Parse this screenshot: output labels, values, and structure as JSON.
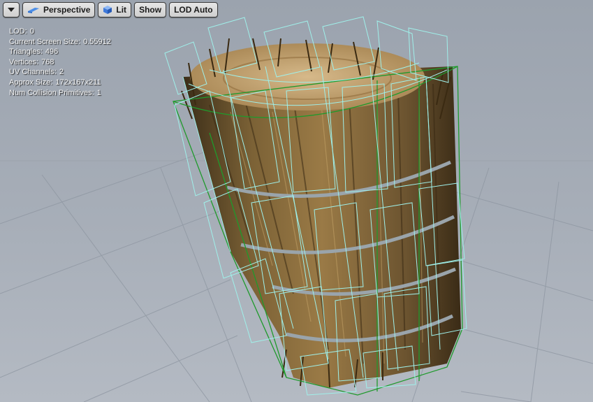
{
  "toolbar": {
    "view_menu_icon": "chevron-down-icon",
    "perspective_label": "Perspective",
    "lit_label": "Lit",
    "show_label": "Show",
    "lod_label": "LOD Auto"
  },
  "stats": [
    {
      "label": "LOD:",
      "value": "0"
    },
    {
      "label": "Current Screen Size:",
      "value": "0.55912"
    },
    {
      "label": "Triangles:",
      "value": "496"
    },
    {
      "label": "Vertices:",
      "value": "768"
    },
    {
      "label": "UV Channels:",
      "value": "2"
    },
    {
      "label": "Approx Size:",
      "value": "172x167x211"
    },
    {
      "label": "Num Collision Primitives:",
      "value": "1"
    }
  ],
  "colors": {
    "background": "#a3aab4",
    "grid": "#8f97a2",
    "wireframe": "#9ff0ea",
    "collision": "#1f9a2c",
    "straw": "#8a6a3a",
    "strap": "#9aa4ab"
  }
}
